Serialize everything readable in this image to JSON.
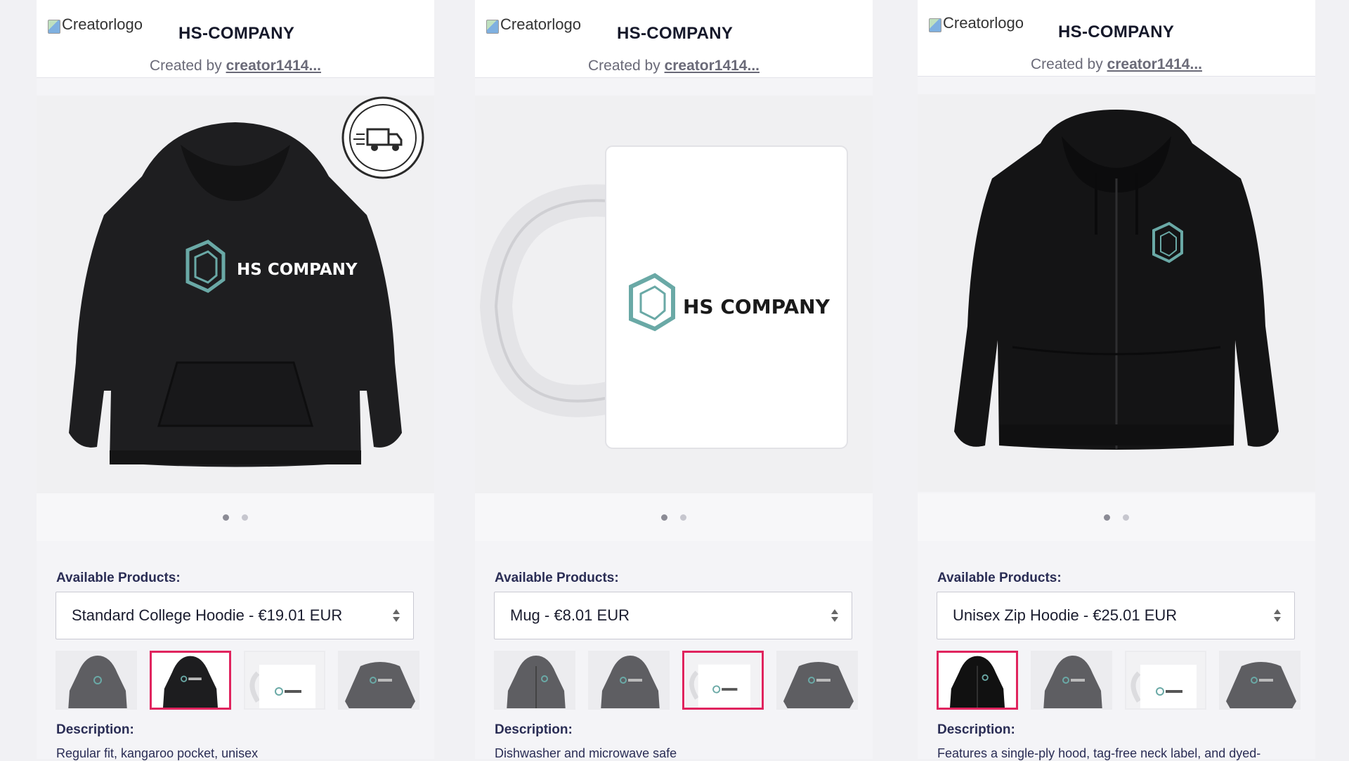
{
  "cards": [
    {
      "logo_alt": "Creatorlogo",
      "store_name": "HS-COMPANY",
      "created_by_prefix": "Created by",
      "creator": "creator1414...",
      "badge_text": "RUSH SHIPPING AVAILABLE",
      "available_label": "Available Products:",
      "selected_product": "Standard College Hoodie - €19.01 EUR",
      "description_label": "Description:",
      "description": "Regular fit, kangaroo pocket, unisex",
      "print_text": "HS COMPANY"
    },
    {
      "logo_alt": "Creatorlogo",
      "store_name": "HS-COMPANY",
      "created_by_prefix": "Created by",
      "creator": "creator1414...",
      "available_label": "Available Products:",
      "selected_product": "Mug - €8.01 EUR",
      "description_label": "Description:",
      "description": "Dishwasher and microwave safe",
      "print_text": "HS COMPANY"
    },
    {
      "logo_alt": "Creatorlogo",
      "store_name": "HS-COMPANY",
      "created_by_prefix": "Created by",
      "creator": "creator1414...",
      "available_label": "Available Products:",
      "selected_product": "Unisex Zip Hoodie - €25.01 EUR",
      "description_label": "Description:",
      "description": "Features a single-ply hood, tag-free neck label, and dyed-",
      "print_text": ""
    }
  ],
  "colors": {
    "selected_border": "#e0245e",
    "brand_teal": "#6aa9a6",
    "label_navy": "#2a2d55"
  },
  "icons": {
    "select_arrows": "up-down-chevron-icon",
    "broken_image": "broken-image-icon"
  }
}
